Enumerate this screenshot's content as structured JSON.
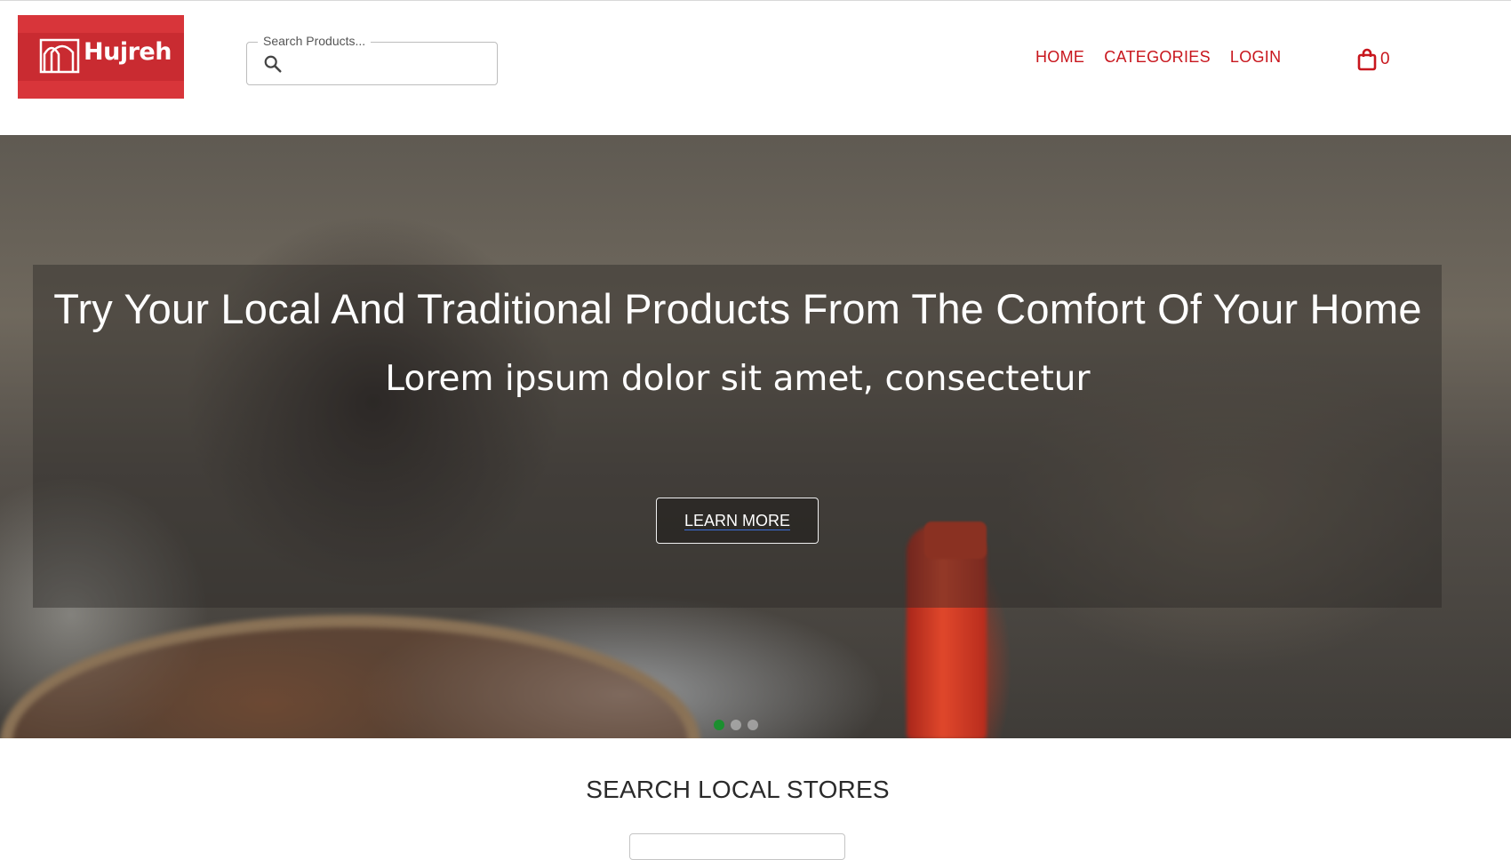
{
  "brand": {
    "name": "Hujreh",
    "color": "#d8353a"
  },
  "search": {
    "legend": "Search Products...",
    "placeholder": "",
    "value": ""
  },
  "nav": {
    "items": [
      {
        "label": "HOME"
      },
      {
        "label": "CATEGORIES"
      },
      {
        "label": "LOGIN"
      }
    ]
  },
  "cart": {
    "count": "0",
    "icon": "shopping-bag-icon"
  },
  "hero": {
    "title": "Try Your Local And Traditional Products From The Comfort Of Your Home",
    "subtitle": "Lorem ipsum dolor sit amet, consectetur",
    "cta_label": "LEARN MORE",
    "slides": 3,
    "active_slide": 1,
    "active_dot_color": "#1b8f2f"
  },
  "stores": {
    "title": "SEARCH LOCAL STORES"
  },
  "colors": {
    "accent": "#c8161d"
  }
}
